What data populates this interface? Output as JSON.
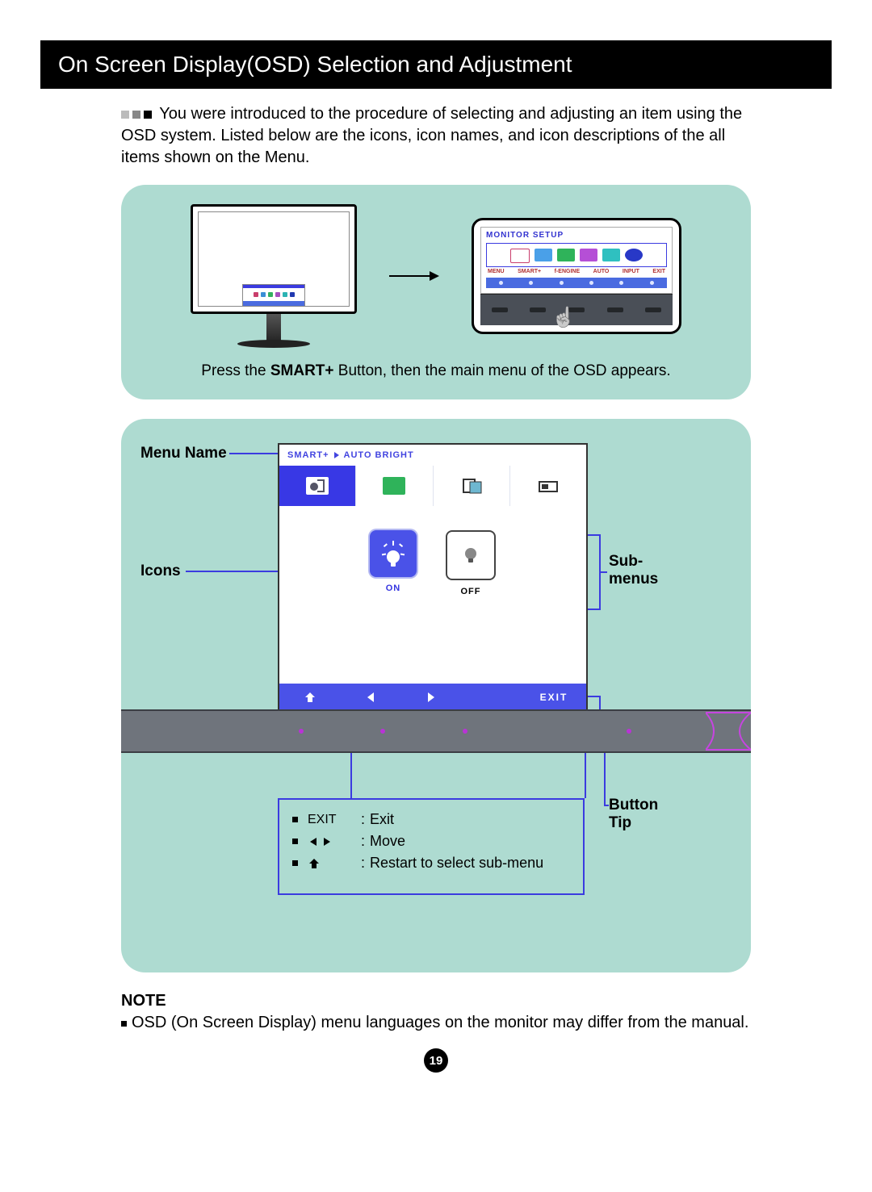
{
  "header": {
    "title": "On Screen Display(OSD) Selection and Adjustment"
  },
  "intro": "You were introduced to the procedure of selecting and adjusting an item using the OSD system. Listed below are the icons, icon names, and icon descriptions of the all items shown on the Menu.",
  "panel1": {
    "zoom_title": "MONITOR SETUP",
    "zoom_labels": [
      "MENU",
      "SMART+",
      "f-ENGINE",
      "AUTO",
      "INPUT",
      "EXIT"
    ],
    "caption_pre": "Press the ",
    "caption_bold": "SMART+",
    "caption_post": " Button, then the main menu of the OSD appears."
  },
  "labels": {
    "menu_name": "Menu Name",
    "icons": "Icons",
    "sub_menus": "Sub-\nmenus",
    "button_tip": "Button\nTip"
  },
  "osd": {
    "header_a": "SMART+",
    "header_b": "AUTO BRIGHT",
    "tabs": [
      {
        "name": "auto-bright-tab",
        "active": true
      },
      {
        "name": "original-ratio-tab",
        "active": false
      },
      {
        "name": "web-tab",
        "active": false
      },
      {
        "name": "cinema-tab",
        "active": false
      }
    ],
    "options": {
      "on": "ON",
      "off": "OFF"
    },
    "footer": {
      "exit": "EXIT"
    }
  },
  "legend": {
    "rows": [
      {
        "sym_text": "EXIT",
        "desc": "Exit"
      },
      {
        "sym_text": "",
        "desc": "Move"
      },
      {
        "sym_text": "",
        "desc": "Restart to select sub-menu"
      }
    ]
  },
  "note": {
    "title": "NOTE",
    "body": "OSD (On Screen Display) menu languages on the monitor may differ from the manual."
  },
  "page_number": "19"
}
